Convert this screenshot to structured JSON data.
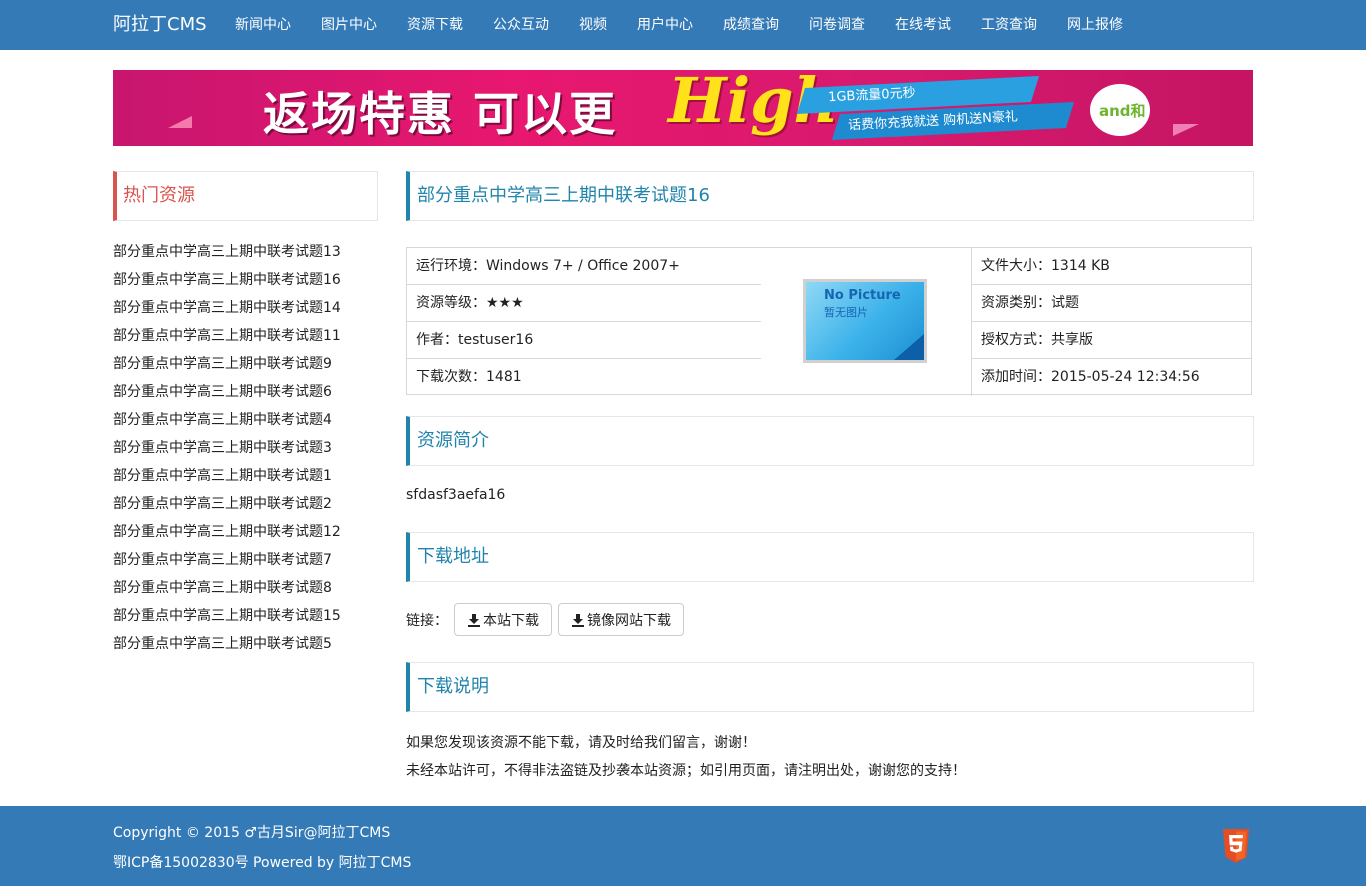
{
  "header": {
    "brand": "阿拉丁CMS",
    "nav": [
      "新闻中心",
      "图片中心",
      "资源下载",
      "公众互动",
      "视频",
      "用户中心",
      "成绩查询",
      "问卷调查",
      "在线考试",
      "工资查询",
      "网上报修"
    ]
  },
  "banner": {
    "headline": "返场特惠 可以更",
    "highlight": "High",
    "ribbon_top": "1GB流量0元秒",
    "ribbon_bottom": "话费你充我就送  购机送N豪礼",
    "logo_text": "and和"
  },
  "sidebar": {
    "title": "热门资源",
    "items": [
      "部分重点中学高三上期中联考试题13",
      "部分重点中学高三上期中联考试题16",
      "部分重点中学高三上期中联考试题14",
      "部分重点中学高三上期中联考试题11",
      "部分重点中学高三上期中联考试题9",
      "部分重点中学高三上期中联考试题6",
      "部分重点中学高三上期中联考试题4",
      "部分重点中学高三上期中联考试题3",
      "部分重点中学高三上期中联考试题1",
      "部分重点中学高三上期中联考试题2",
      "部分重点中学高三上期中联考试题12",
      "部分重点中学高三上期中联考试题7",
      "部分重点中学高三上期中联考试题8",
      "部分重点中学高三上期中联考试题15",
      "部分重点中学高三上期中联考试题5"
    ]
  },
  "resource": {
    "title": "部分重点中学高三上期中联考试题16",
    "env": "运行环境：Windows 7+ / Office 2007+",
    "level": "资源等级：★★★",
    "author": "作者：testuser16",
    "downloads": "下载次数：1481",
    "size": "文件大小：1314 KB",
    "category": "资源类别：试题",
    "license": "授权方式：共享版",
    "added": "添加时间：2015-05-24 12:34:56",
    "image_title": "No Picture",
    "image_subtitle": "暂无图片"
  },
  "intro": {
    "title": "资源简介",
    "text": "sfdasf3aefa16"
  },
  "download": {
    "title": "下载地址",
    "label": "链接：",
    "local_button": "本站下载",
    "mirror_button": "镜像网站下载"
  },
  "notes": {
    "title": "下载说明",
    "line1": "如果您发现该资源不能下载，请及时给我们留言，谢谢！",
    "line2": "未经本站许可，不得非法盗链及抄袭本站资源；如引用页面，请注明出处，谢谢您的支持！"
  },
  "footer": {
    "copyright": "Copyright © 2015 ♂古月Sir@阿拉丁CMS",
    "icp": "鄂ICP备15002830号 Powered by 阿拉丁CMS"
  },
  "colors": {
    "primary": "#337ab7",
    "accent_red": "#d9534f",
    "accent_teal": "#2184ab",
    "html5_orange": "#e44d26"
  }
}
